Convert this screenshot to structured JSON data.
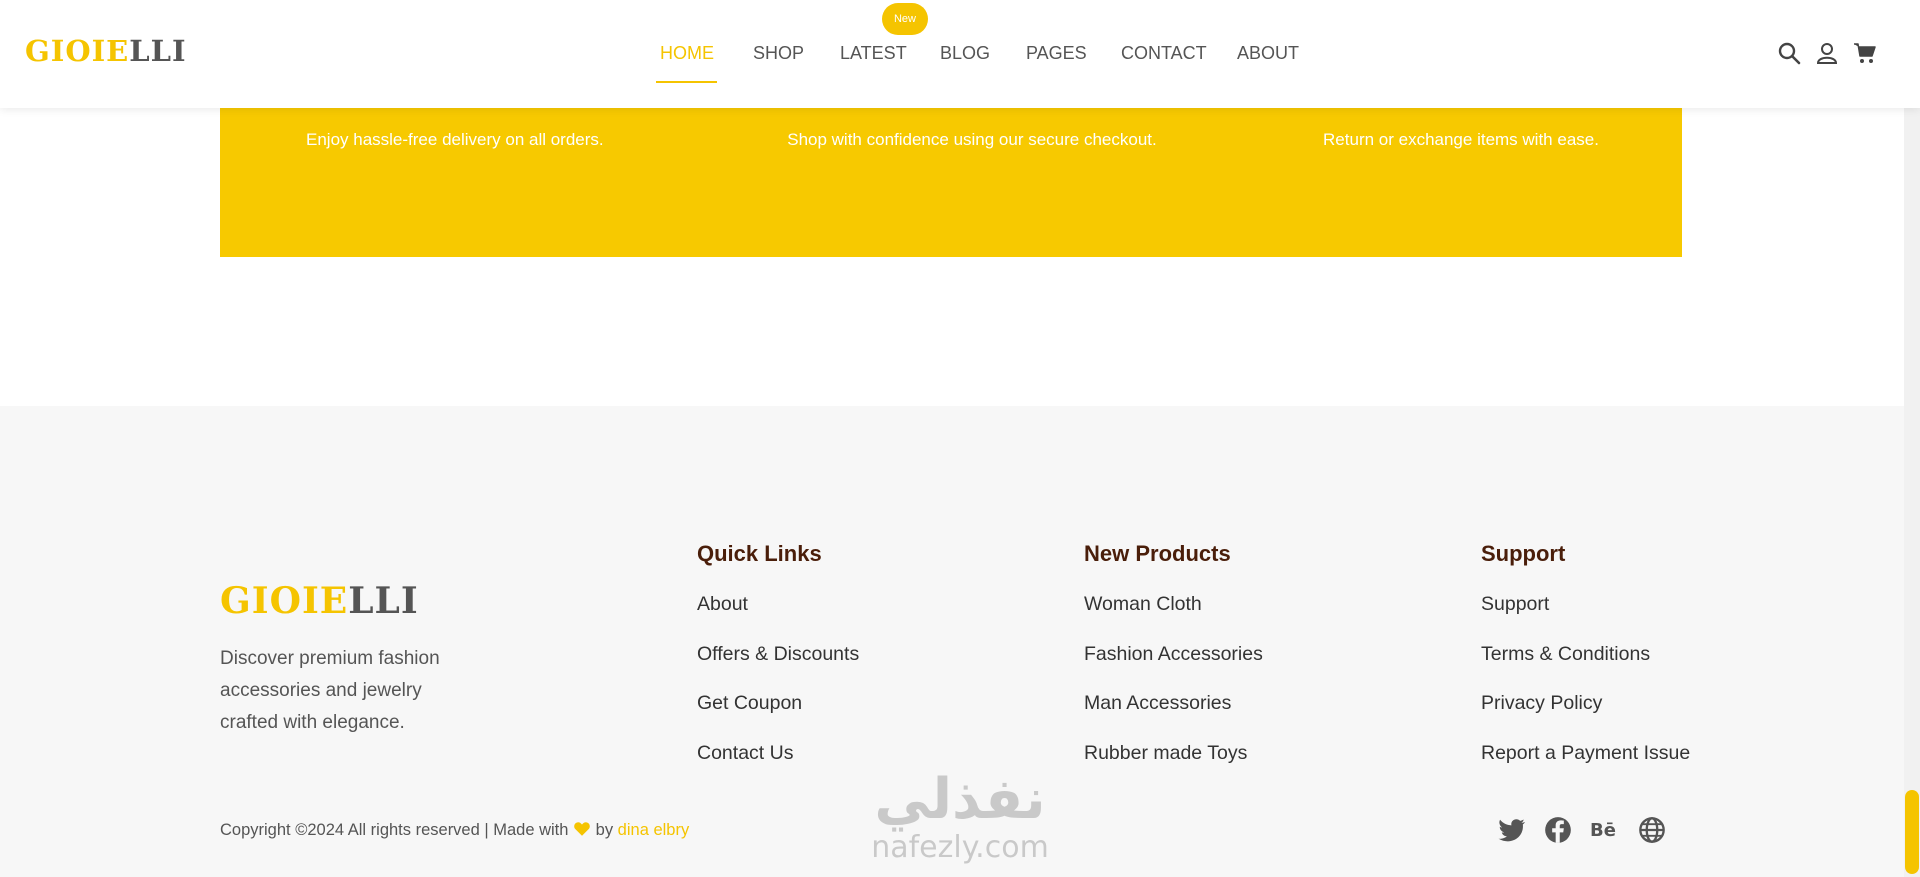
{
  "header": {
    "logo_part1": "GIOIE",
    "logo_part2": "LLI",
    "nav": [
      "HOME",
      "SHOP",
      "LATEST",
      "BLOG",
      "PAGES",
      "CONTACT",
      "ABOUT"
    ],
    "active_nav": "HOME",
    "badge": "New",
    "icons": [
      "search-icon",
      "user-icon",
      "cart-icon"
    ]
  },
  "features": [
    {
      "text": "Enjoy hassle-free delivery on all orders.",
      "icon": "delivery-icon"
    },
    {
      "text": "Shop with confidence using our secure checkout.",
      "icon": "secure-icon"
    },
    {
      "text": "Return or exchange items with ease.",
      "icon": "return-icon"
    }
  ],
  "footer": {
    "logo_part1": "GIOIE",
    "logo_part2": "LLI",
    "description": "Discover premium fashion accessories and jewelry crafted with elegance.",
    "columns": [
      {
        "title": "Quick Links",
        "links": [
          "About",
          "Offers & Discounts",
          "Get Coupon",
          "Contact Us"
        ]
      },
      {
        "title": "New Products",
        "links": [
          "Woman Cloth",
          "Fashion Accessories",
          "Man Accessories",
          "Rubber made Toys"
        ]
      },
      {
        "title": "Support",
        "links": [
          "Support",
          "Terms & Conditions",
          "Privacy Policy",
          "Report a Payment Issue"
        ]
      }
    ],
    "copyright_prefix": "Copyright ©2024 All rights reserved | Made with",
    "copyright_by": "by",
    "author": "dina elbry",
    "social": [
      "twitter-icon",
      "facebook-icon",
      "behance-icon",
      "globe-icon"
    ]
  },
  "watermark": {
    "arabic": "نفذلي",
    "latin": "nafezly.com"
  },
  "colors": {
    "accent": "#f5c400",
    "band": "#f7c900",
    "footer_bg": "#f7f7f7",
    "heading": "#4a1e0a"
  }
}
